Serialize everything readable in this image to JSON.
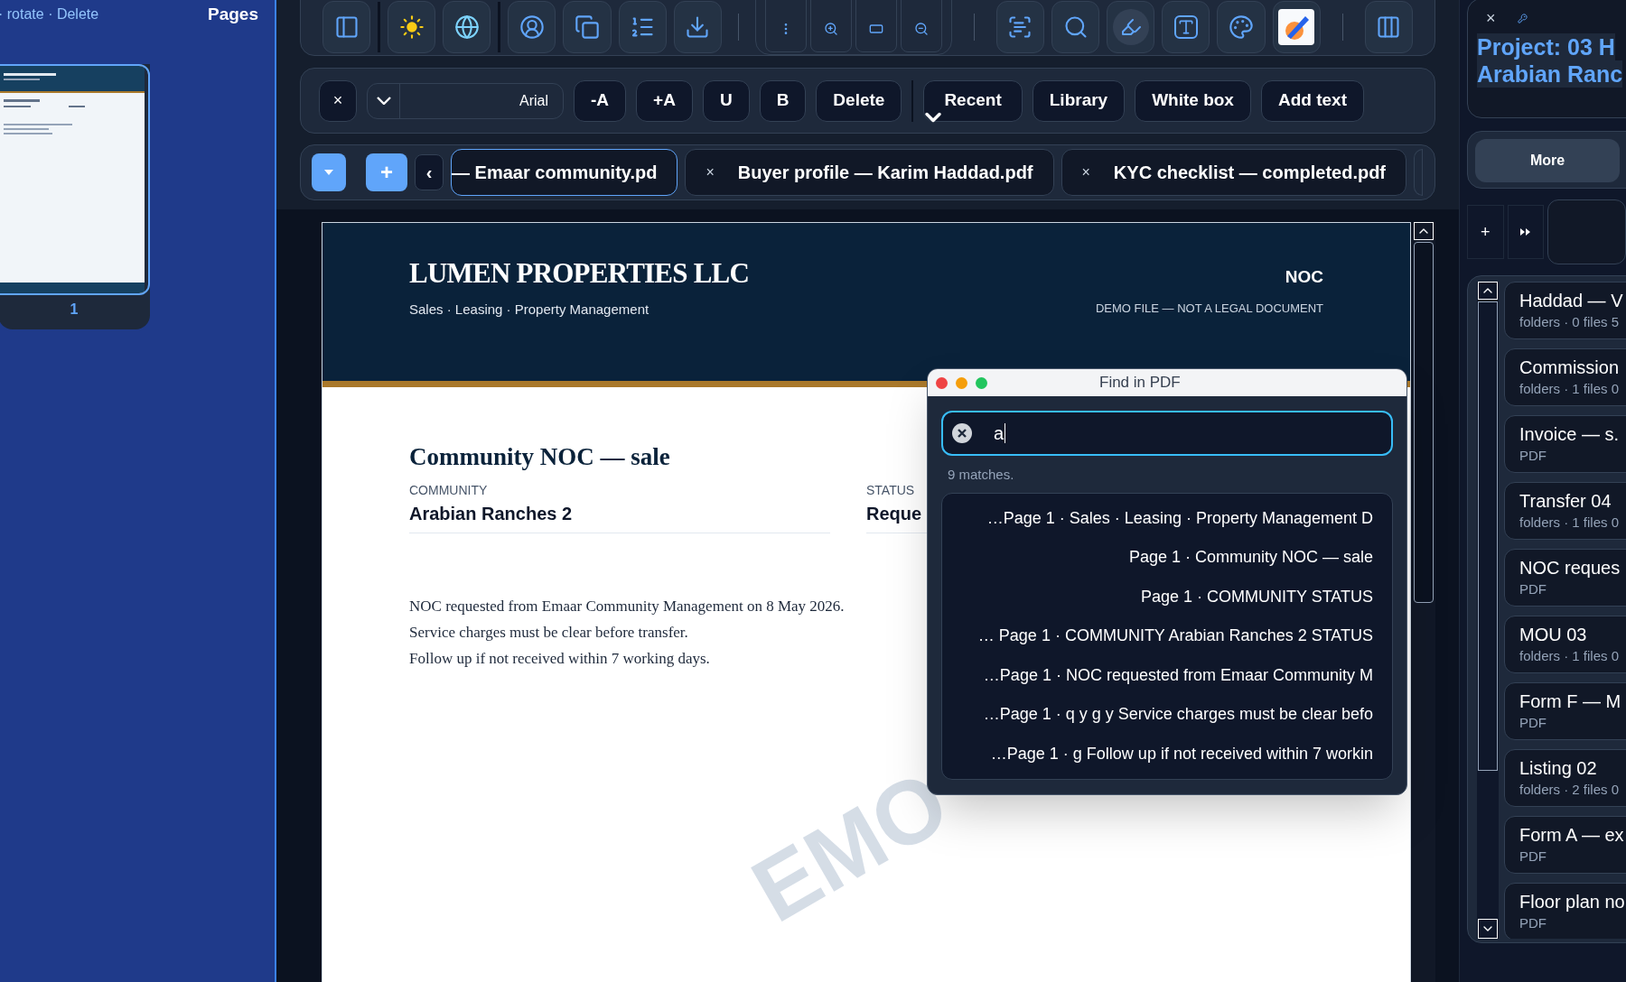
{
  "left_panel": {
    "actions": "· rotate · Delete",
    "title": "Pages",
    "thumbnails": [
      {
        "label": "1",
        "selected": true
      }
    ]
  },
  "format_bar": {
    "close": "×",
    "font": "Arial",
    "buttons": [
      "-A",
      "+A",
      "U",
      "B",
      "Delete"
    ],
    "recent": "Recent",
    "buttons_2": [
      "Library",
      "White box",
      "Add text"
    ]
  },
  "tab_bar": {
    "prev": "‹",
    "add": "+",
    "tabs": [
      {
        "label": "— Emaar community.pd",
        "selected": true
      },
      {
        "close": "×",
        "label": "Buyer profile — Karim Haddad.pdf",
        "selected": false
      },
      {
        "close": "×",
        "label": "KYC checklist — completed.pdf",
        "selected": false
      }
    ]
  },
  "document": {
    "company": "LUMEN PROPERTIES LLC",
    "tagline": "Sales · Leasing · Property Management",
    "doc_type": "NOC",
    "disclaimer": "DEMO FILE — NOT A LEGAL DOCUMENT",
    "title": "Community NOC — sale",
    "fields": [
      {
        "label": "COMMUNITY",
        "value": "Arabian Ranches 2"
      },
      {
        "label": "STATUS",
        "value": "Reque"
      }
    ],
    "body": [
      "NOC requested from Emaar Community Management on 8 May 2026.",
      "Service charges must be clear before transfer.",
      "Follow up if not received within 7 working days."
    ],
    "watermark": "EMO"
  },
  "find_dialog": {
    "title": "Find in PDF",
    "query": "a",
    "count": "9 matches.",
    "results": [
      "…Page 1 · Sales · Leasing · Property Management D",
      "Page 1 · Community NOC — sale",
      "Page 1 · COMMUNITY STATUS",
      "… Page 1 · COMMUNITY Arabian Ranches 2 STATUS",
      "…Page 1 · NOC requested from Emaar Community M",
      "…Page 1 · q y g y Service charges must be clear befo",
      "…Page 1 · g Follow up if not received within 7 workin"
    ]
  },
  "right_panel": {
    "close": "×",
    "project_title": [
      "Project: 03 H",
      "Arabian Ranc"
    ],
    "more": "More",
    "add": "+",
    "items": [
      {
        "title": "Haddad — V",
        "subtitle": "folders · 0 files 5"
      },
      {
        "title": "Commission",
        "subtitle": "folders · 1 files 0"
      },
      {
        "title": "Invoice — s.",
        "subtitle": "PDF"
      },
      {
        "title": "Transfer 04",
        "subtitle": "folders · 1 files 0"
      },
      {
        "title": "NOC reques",
        "subtitle": "PDF"
      },
      {
        "title": "MOU 03",
        "subtitle": "folders · 1 files 0"
      },
      {
        "title": "Form F — M",
        "subtitle": "PDF"
      },
      {
        "title": "Listing 02",
        "subtitle": "folders · 2 files 0"
      },
      {
        "title": "Form A — ex",
        "subtitle": "PDF"
      },
      {
        "title": "Floor plan no",
        "subtitle": "PDF"
      }
    ]
  }
}
